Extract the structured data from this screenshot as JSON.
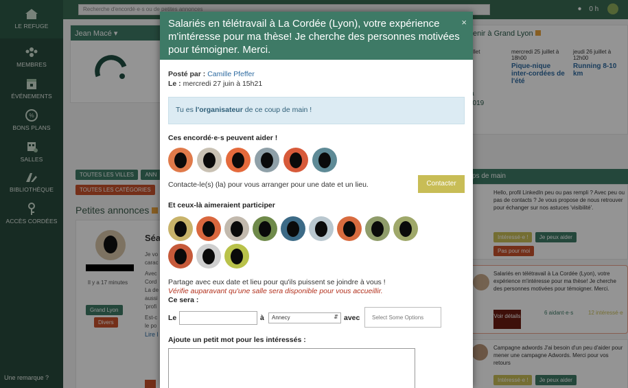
{
  "sidebar": {
    "items": [
      {
        "label": "LE REFUGE",
        "icon": "home-icon"
      },
      {
        "label": "MEMBRES",
        "icon": "members-icon"
      },
      {
        "label": "ÉVÉNEMENTS",
        "icon": "calendar-icon"
      },
      {
        "label": "BONS PLANS",
        "icon": "percent-icon"
      },
      {
        "label": "SALLES",
        "icon": "rooms-icon"
      },
      {
        "label": "BIBLIOTHÈQUE",
        "icon": "library-icon"
      },
      {
        "label": "ACCÈS CORDÉES",
        "icon": "key-icon"
      }
    ],
    "remark": "Une remarque ?"
  },
  "topbar": {
    "search_placeholder": "Recherche d'encordé·e·s ou de petites annonces",
    "status": "0 h"
  },
  "background": {
    "location_select": "Jean Macé",
    "agenda_title": "enir à Grand Lyon",
    "events": [
      {
        "date": "uillet",
        "title": ""
      },
      {
        "date": "mercredi 25 juillet à 18h00",
        "title": "Pique-nique inter-cordées de l'été"
      },
      {
        "date": "jeudi 26 juillet à 12h00",
        "title": "Running 8-10 km"
      }
    ],
    "event_fragment_1": "a",
    "event_fragment_2": "2019",
    "filters": [
      "TOUTES LES VILLES",
      "ANN",
      "TOUTES LES CATÉGORIES"
    ],
    "ads_title": "Petites annonces",
    "ad": {
      "time": "Il y a 17 minutes",
      "city": "Grand Lyon",
      "category": "Divers",
      "title": "Séa",
      "lines": [
        "Je vo",
        "carac",
        "Avec",
        "Cord",
        "La de",
        "aussi",
        "'profi",
        "Est-c",
        "le po",
        "Lire l"
      ]
    },
    "help_title": "ps de main",
    "help_items": [
      {
        "text": "Hello, profil LinkedIn peu ou pas rempli ? Avec peu ou pas de contacts ? Je vous propose de nous retrouver pour échanger sur nos astuces 'visibilité'.",
        "tag1": "Intéressé·e !",
        "tag2": "Je peux aider",
        "tag3": "Pas pour moi"
      },
      {
        "text": "Salariés en télétravail à La Cordée (Lyon), votre expérience m'intéresse pour ma thèse! Je cherche des personnes motivées pour témoigner. Merci.",
        "view": "Voir détails",
        "helpers": "6 aidant·e·s",
        "interested": "12 intéressé·e"
      },
      {
        "text": "Campagne adwords J'ai besoin d'un peu d'aider pour mener une campagne Adwords. Merci pour vos retours",
        "tag1": "Intéressé·e !",
        "tag2": "Je peux aider"
      }
    ]
  },
  "modal": {
    "title": "Salariés en télétravail à La Cordée (Lyon), votre expérience m'intéresse pour ma thèse! Je cherche des personnes motivées pour témoigner. Merci.",
    "close": "×",
    "posted_by_label": "Posté par :",
    "posted_by": "Camille Pfeffer",
    "date_label": "Le :",
    "date": "mercredi 27 juin à 15h21",
    "organizer_prefix": "Tu es ",
    "organizer_strong": "l'organisateur",
    "organizer_suffix": " de ce coup de main !",
    "helpers_title": "Ces encordé·e·s peuvent aider !",
    "contact_text": "Contacte-le(s) (la) pour vous arranger pour une date et un lieu.",
    "contact_button": "Contacter",
    "interested_title": "Et ceux-là aimeraient participer",
    "share_text": "Partage avec eux date et lieu pour qu'ils puissent se joindre à vous !",
    "warning": "Vérifie auparavant qu'une salle sera disponible pour vous accueillir.",
    "ce_sera": "Ce sera :",
    "le_label": "Le",
    "a_label": "à",
    "city_value": "Annecy",
    "avec_label": "avec",
    "options_placeholder": "Select Some Options",
    "note_label": "Ajoute un petit mot pour les intéressés :",
    "colors": {
      "header": "#3e7a66",
      "accent": "#c8bd56",
      "warning": "#b2301c"
    }
  }
}
